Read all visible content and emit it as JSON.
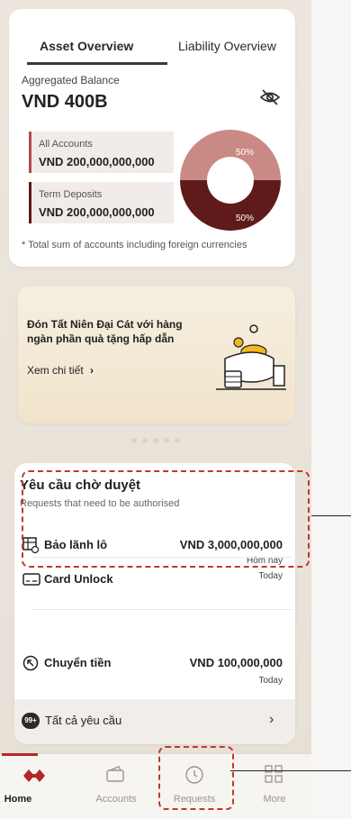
{
  "overview": {
    "tabs": [
      "Asset Overview",
      "Liability Overview"
    ],
    "aggregated_label": "Aggregated Balance",
    "aggregated_value": "VND 400B",
    "all_accounts_label": "All Accounts",
    "all_accounts_value": "VND 200,000,000,000",
    "term_deposits_label": "Term Deposits",
    "term_deposits_value": "VND 200,000,000,000",
    "donut": {
      "top_pct": "50%",
      "bottom_pct": "50%",
      "top_color": "#c98a86",
      "bottom_color": "#5f1a1a"
    },
    "footnote": "* Total sum of accounts including foreign currencies"
  },
  "promo": {
    "text": "Đón Tất Niên Đại Cát với hàng ngàn phần quà tặng hấp dẫn",
    "link": "Xem chi tiết"
  },
  "requests": {
    "title": "Yêu cầu chờ duyệt",
    "subtitle": "Requests that need to be authorised",
    "items": [
      {
        "icon": "grid-check-icon",
        "label": "Bảo lãnh lô",
        "amount": "VND 3,000,000,000",
        "date": "Hôm nay"
      },
      {
        "icon": "card-unlock-icon",
        "label": "Card Unlock",
        "amount": "",
        "date": "Today"
      },
      {
        "icon": "arrow-circle-icon",
        "label": "Chuyển tiền",
        "amount": "VND 100,000,000",
        "date": "Today"
      }
    ],
    "all_badge": "99+",
    "all_label": "Tất cả yêu cầu"
  },
  "nav": {
    "items": [
      {
        "label": "Home",
        "active": true
      },
      {
        "label": "Accounts",
        "active": false
      },
      {
        "label": "Requests",
        "active": false
      },
      {
        "label": "More",
        "active": false
      }
    ]
  },
  "colors": {
    "accent": "#b3262b",
    "dash": "#c0392b"
  }
}
